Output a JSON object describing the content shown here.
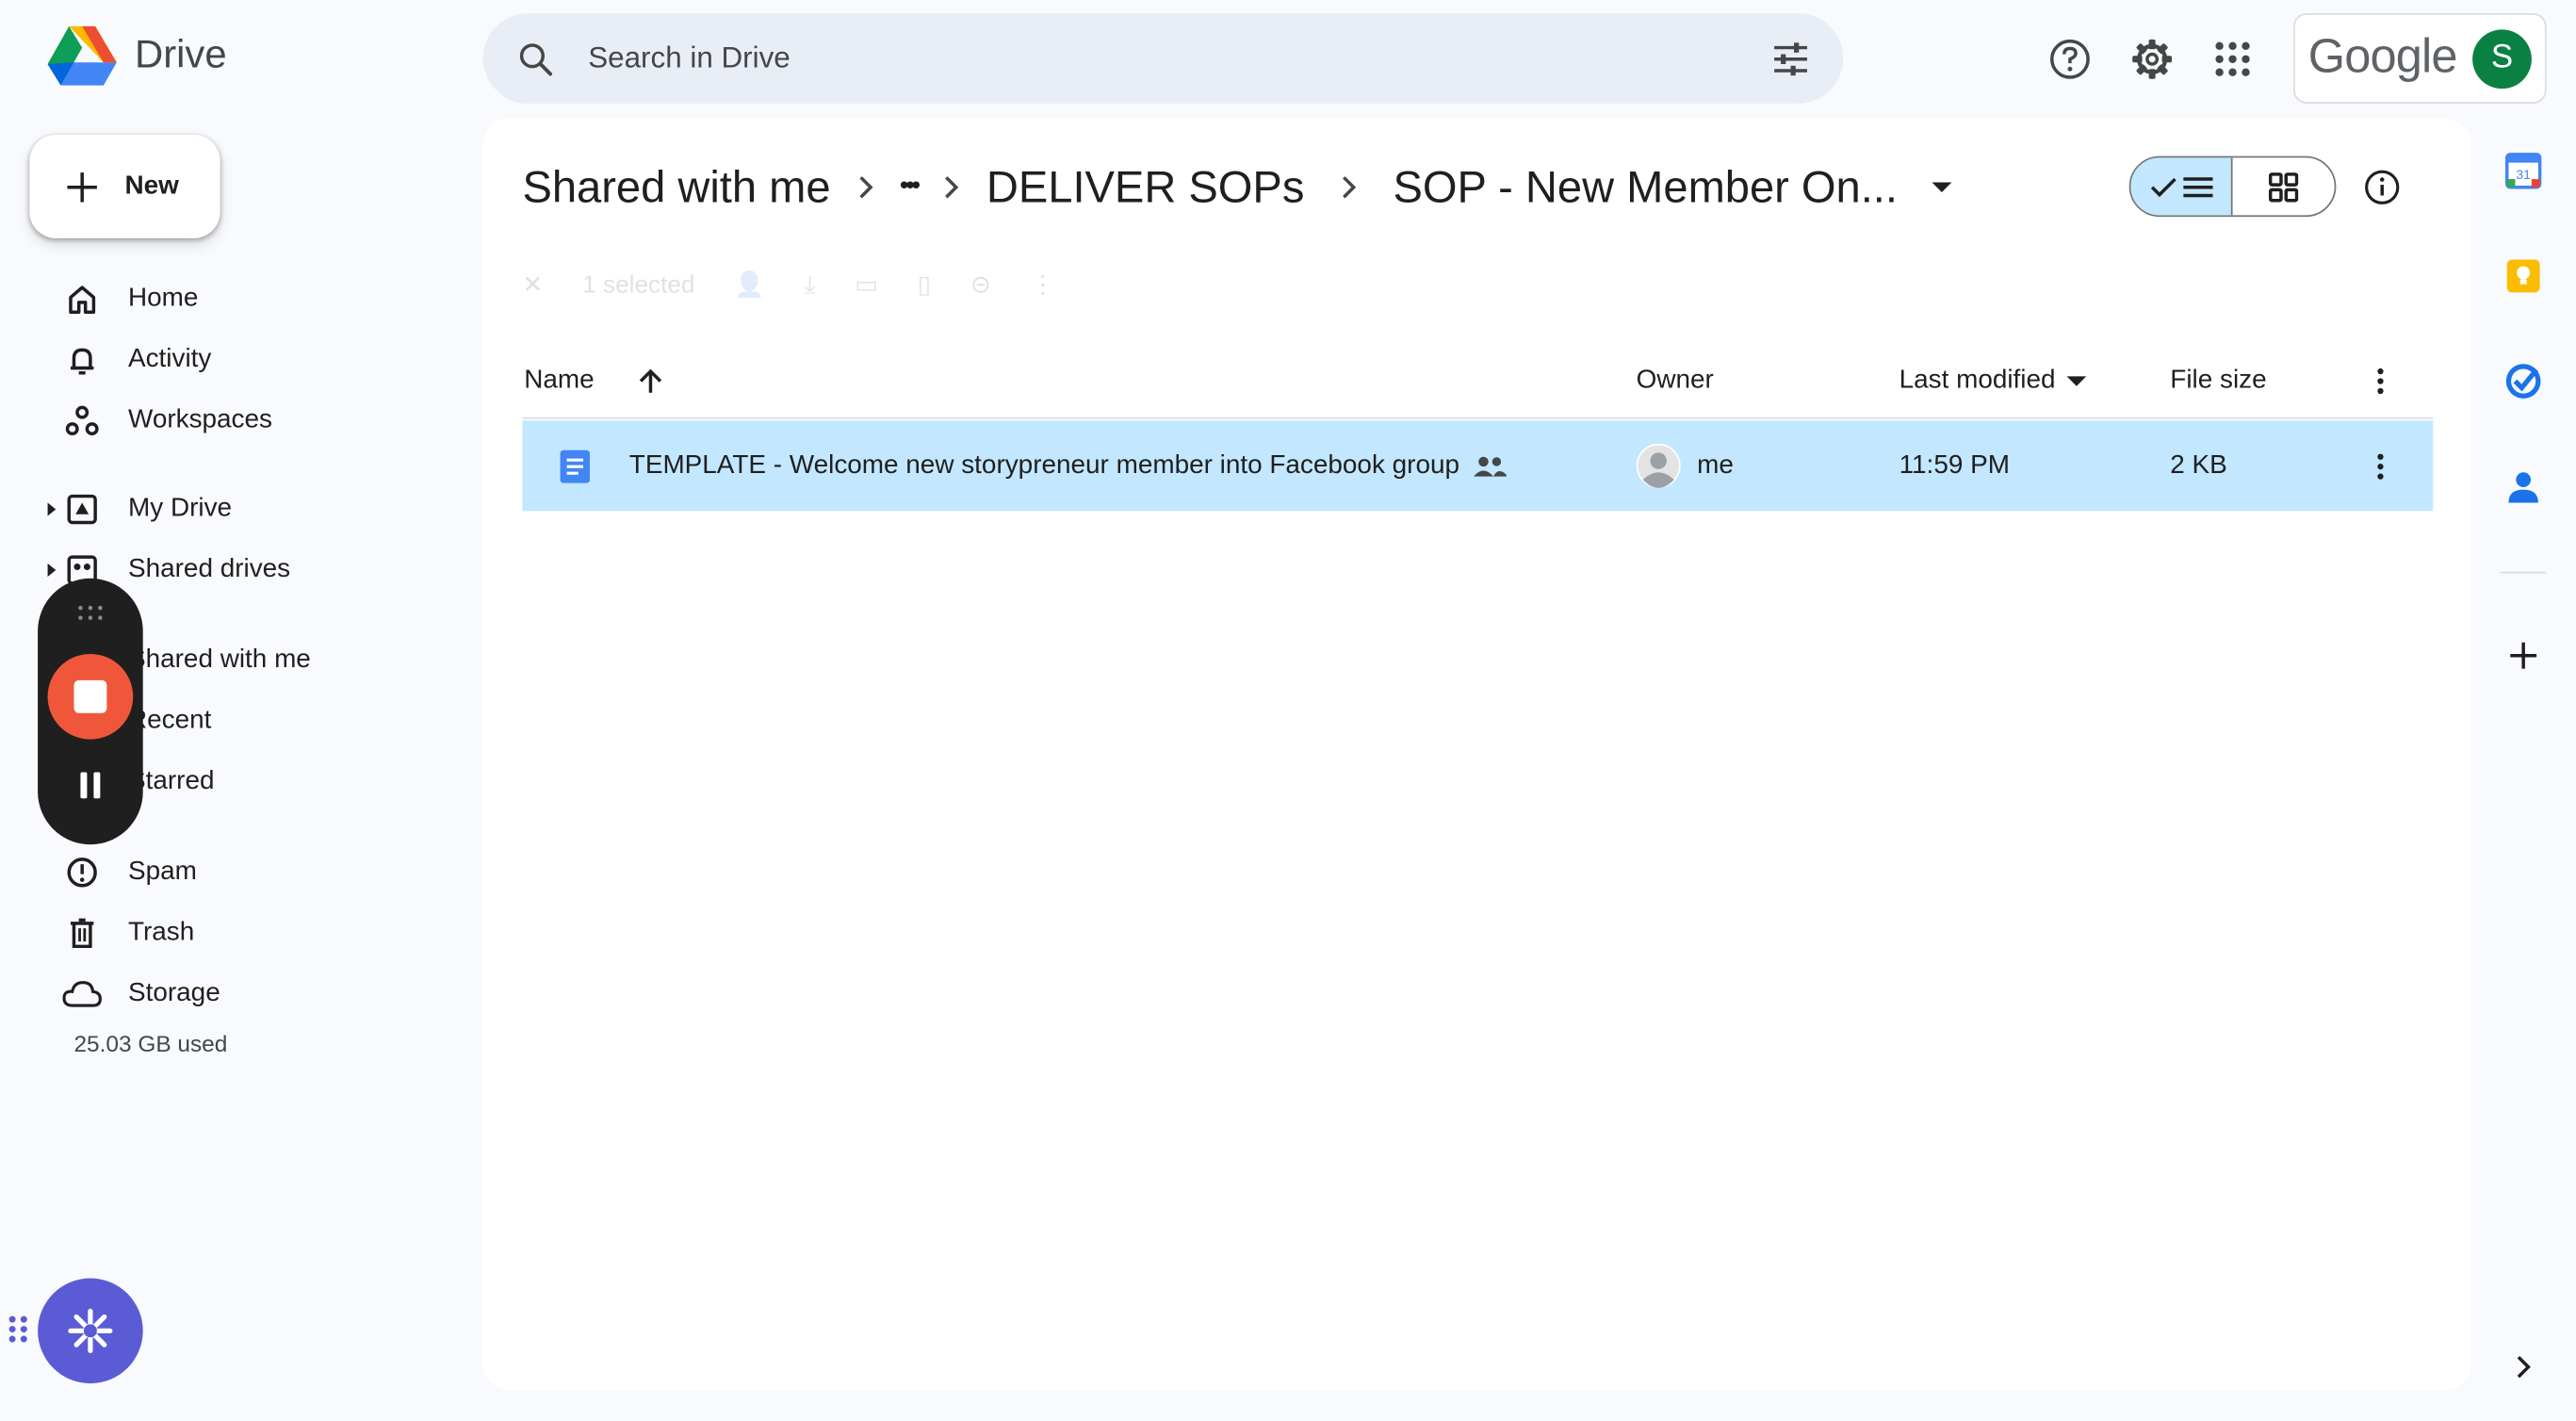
{
  "app": {
    "name": "Drive"
  },
  "search": {
    "placeholder": "Search in Drive"
  },
  "header": {
    "help_icon": "help-circle-icon",
    "settings_icon": "gear-icon",
    "apps_icon": "apps-grid-icon",
    "account_brand": "Google",
    "account_initial": "S"
  },
  "sidebar": {
    "new_label": "New",
    "items": [
      {
        "label": "Home",
        "icon": "home-icon"
      },
      {
        "label": "Activity",
        "icon": "bell-icon"
      },
      {
        "label": "Workspaces",
        "icon": "workspaces-icon"
      },
      {
        "label": "My Drive",
        "icon": "my-drive-icon"
      },
      {
        "label": "Shared drives",
        "icon": "shared-drives-icon"
      },
      {
        "label": "Shared with me",
        "icon": "people-icon"
      },
      {
        "label": "Recent",
        "icon": "clock-icon"
      },
      {
        "label": "Starred",
        "icon": "star-icon"
      },
      {
        "label": "Spam",
        "icon": "spam-icon"
      },
      {
        "label": "Trash",
        "icon": "trash-icon"
      },
      {
        "label": "Storage",
        "icon": "cloud-icon"
      }
    ],
    "storage_used": "25.03 GB used"
  },
  "breadcrumb": {
    "items": [
      "Shared with me",
      "•••",
      "DELIVER SOPs",
      "SOP - New Member On..."
    ]
  },
  "toolbar": {
    "selected_text": "1 selected"
  },
  "table": {
    "columns": [
      "Name",
      "Owner",
      "Last modified",
      "File size"
    ],
    "rows": [
      {
        "name": "TEMPLATE - Welcome new storypreneur member into Facebook group",
        "owner": "me",
        "modified": "11:59 PM",
        "size": "2 KB",
        "selected": true
      }
    ]
  },
  "colors": {
    "selected_row": "#c2e7ff",
    "search_bg": "#e9eef6",
    "page_bg": "#f8fafd",
    "record_stop": "#f0573a",
    "fab": "#5b5bd6"
  }
}
